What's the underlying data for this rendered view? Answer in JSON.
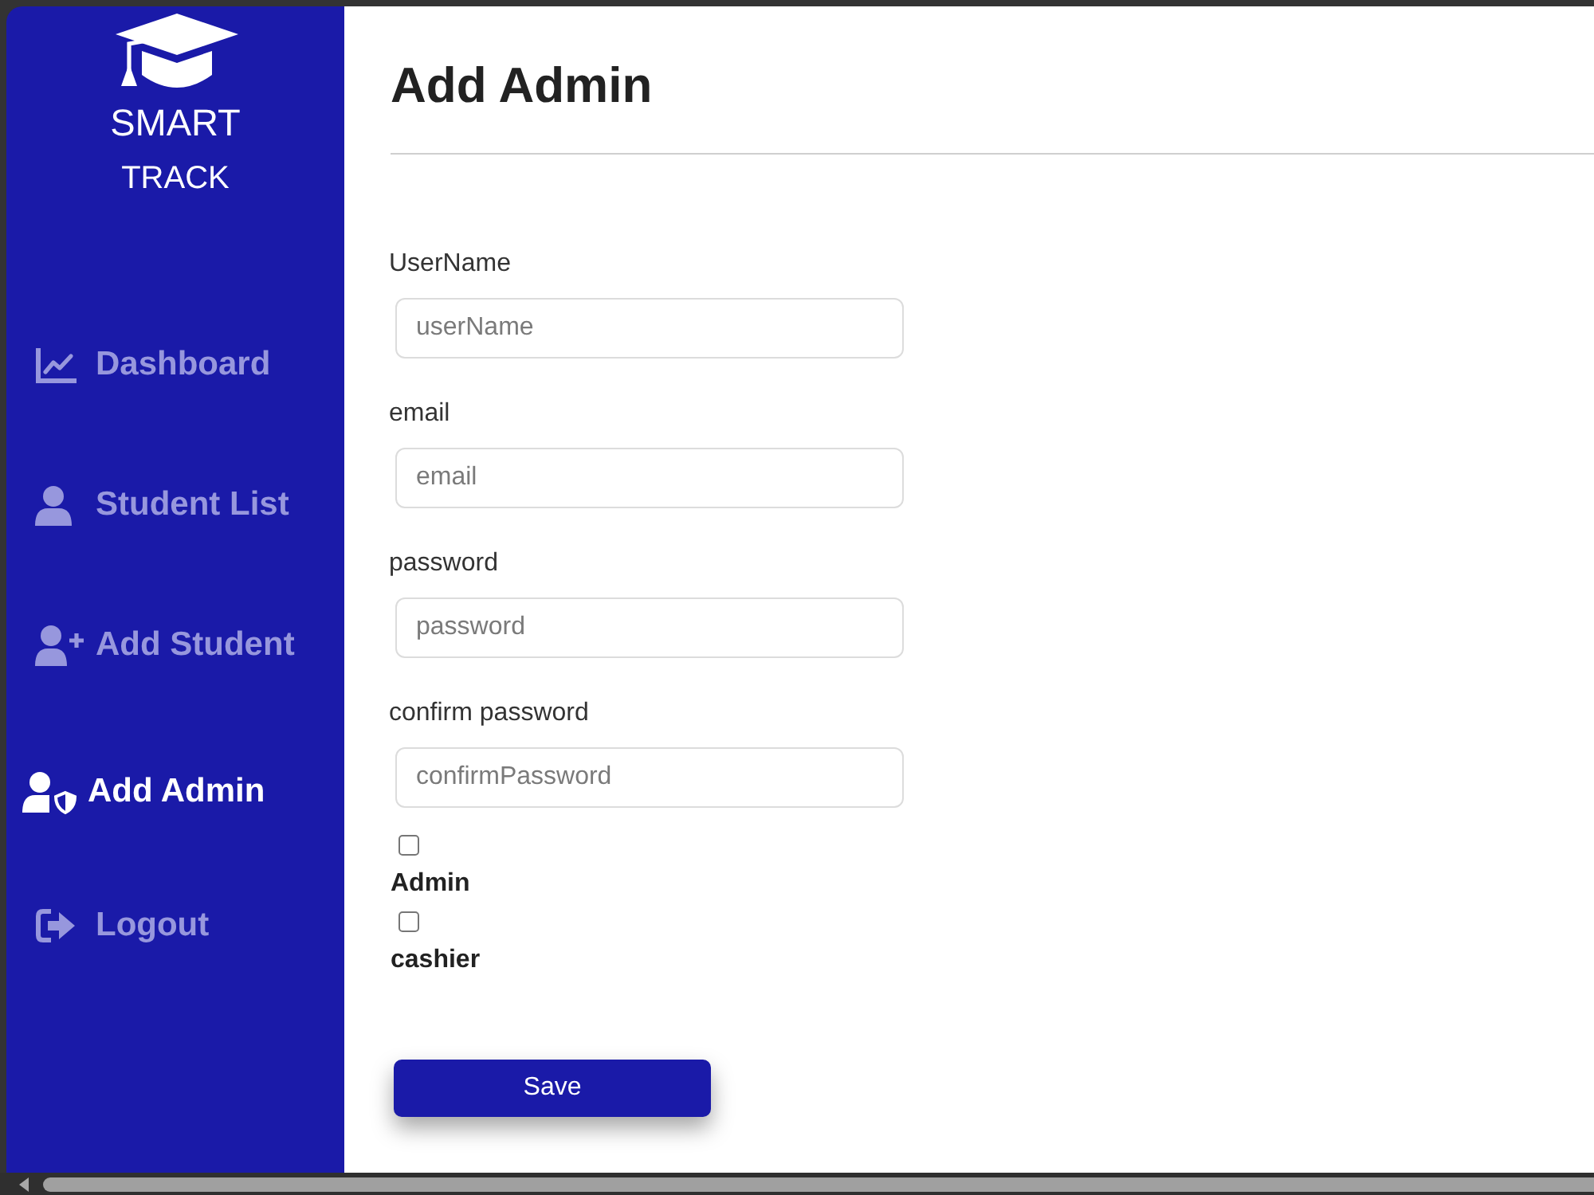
{
  "sidebar": {
    "logo": {
      "line_1": "SMART",
      "line_2": "TRACK"
    },
    "items": [
      {
        "kind": "chart",
        "label": "Dashboard",
        "selected": false
      },
      {
        "kind": "user",
        "label": "Student List",
        "selected": false
      },
      {
        "kind": "adduser",
        "label": "Add Student",
        "selected": false
      },
      {
        "kind": "admin",
        "label": "Add Admin",
        "selected": true
      },
      {
        "kind": "logout",
        "label": "Logout",
        "selected": false
      }
    ]
  },
  "main": {
    "title": "Add Admin"
  },
  "form": {
    "fields": [
      {
        "label": "UserName",
        "placeholder": "userName"
      },
      {
        "label": "email",
        "placeholder": "email"
      },
      {
        "label": "password",
        "placeholder": "password"
      },
      {
        "label": "confirm password",
        "placeholder": "confirmPassword"
      }
    ],
    "roles": [
      {
        "label": "Admin",
        "checked": false
      },
      {
        "label": "cashier",
        "checked": false
      }
    ],
    "save_button": "Save"
  }
}
